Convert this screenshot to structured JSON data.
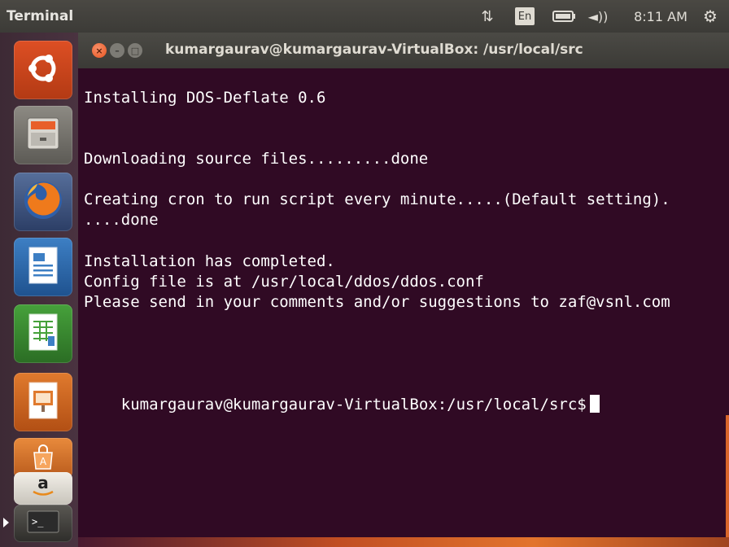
{
  "panel": {
    "app_name": "Terminal",
    "keyboard_layout": "En",
    "clock": "8:11 AM",
    "icons": [
      "network-icon",
      "keyboard-indicator",
      "battery-icon",
      "volume-icon",
      "power-gear-icon"
    ]
  },
  "launcher": {
    "items": [
      {
        "name": "dash-home",
        "icon": "ubuntu-logo-icon"
      },
      {
        "name": "files",
        "icon": "file-cabinet-icon"
      },
      {
        "name": "firefox",
        "icon": "firefox-icon"
      },
      {
        "name": "libreoffice-writer",
        "icon": "writer-document-icon"
      },
      {
        "name": "libreoffice-calc",
        "icon": "spreadsheet-icon"
      },
      {
        "name": "libreoffice-impress",
        "icon": "presentation-icon"
      },
      {
        "name": "software-center",
        "icon": "shopping-bag-icon"
      },
      {
        "name": "amazon",
        "icon": "amazon-icon"
      },
      {
        "name": "terminal",
        "icon": "terminal-icon"
      }
    ]
  },
  "window": {
    "title": "kumargaurav@kumargaurav-VirtualBox: /usr/local/src",
    "colors": {
      "background": "#300a24",
      "text": "#ffffff"
    }
  },
  "terminal": {
    "lines": [
      "Installing DOS-Deflate 0.6",
      "Downloading source files.........done",
      "Creating cron to run script every minute.....(Default setting).",
      "....done",
      "Installation has completed.",
      "Config file is at /usr/local/ddos/ddos.conf",
      "Please send in your comments and/or suggestions to zaf@vsnl.com",
      "kumargaurav@kumargaurav-VirtualBox:/usr/local/src$"
    ]
  }
}
